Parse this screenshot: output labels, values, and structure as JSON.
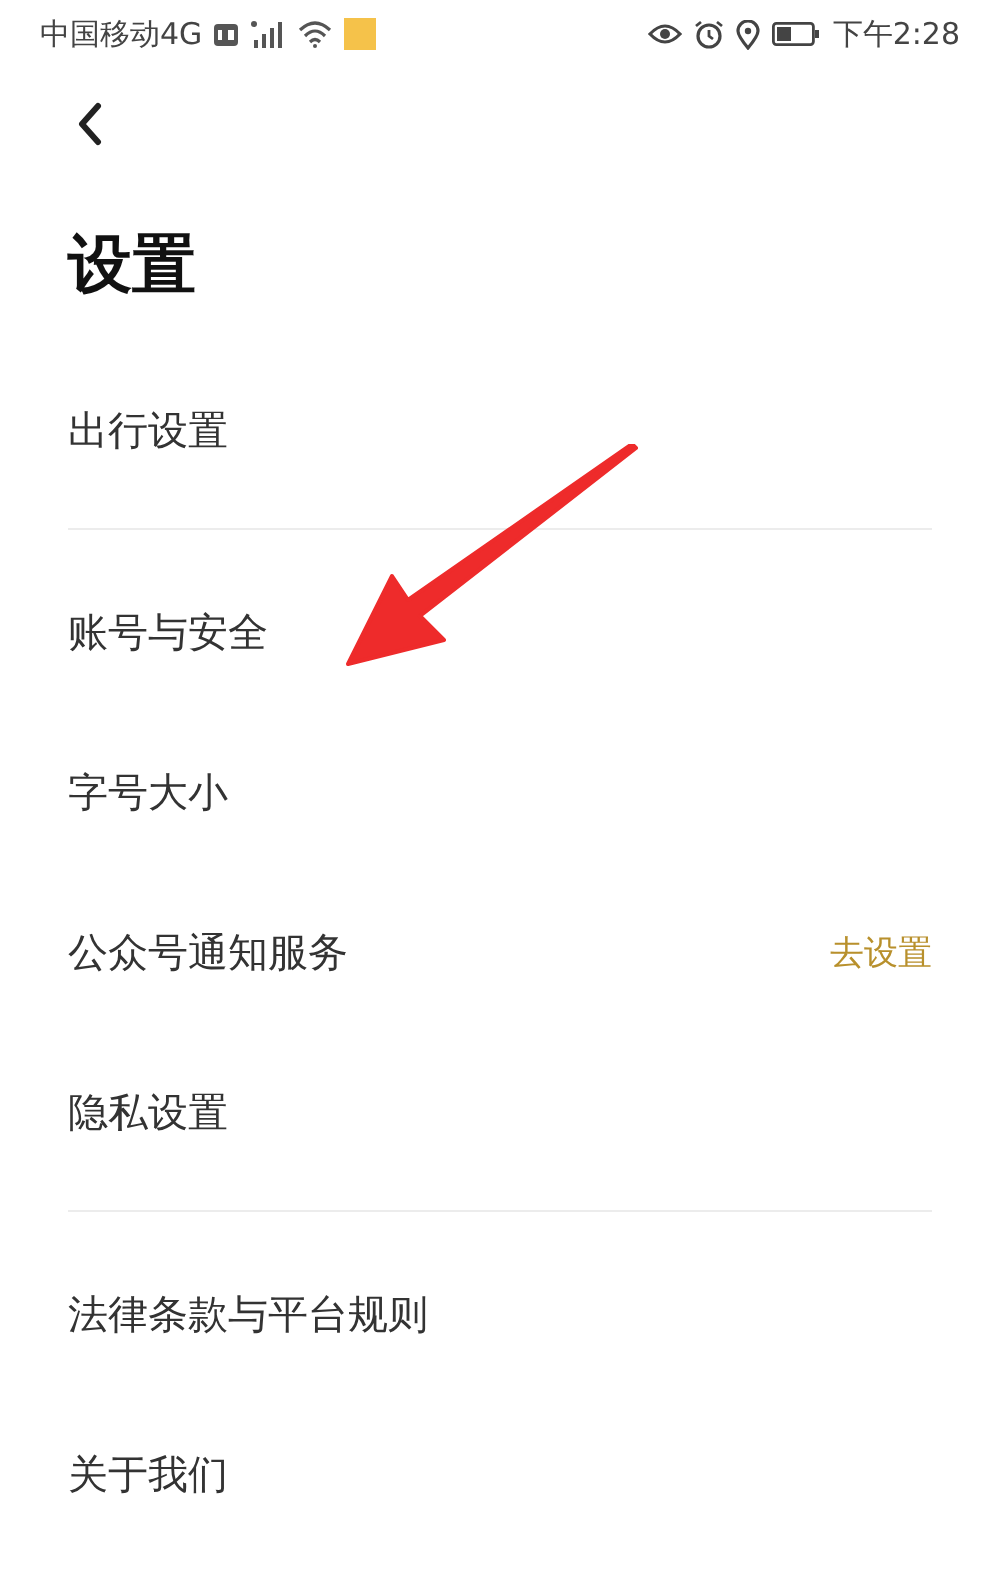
{
  "status_bar": {
    "carrier": "中国移动4G",
    "time": "下午2:28"
  },
  "title": "设置",
  "groups": [
    {
      "items": [
        {
          "label": "出行设置"
        }
      ]
    },
    {
      "items": [
        {
          "label": "账号与安全"
        },
        {
          "label": "字号大小"
        },
        {
          "label": "公众号通知服务",
          "action": "去设置"
        },
        {
          "label": "隐私设置"
        }
      ]
    },
    {
      "items": [
        {
          "label": "法律条款与平台规则"
        },
        {
          "label": "关于我们"
        }
      ]
    }
  ]
}
